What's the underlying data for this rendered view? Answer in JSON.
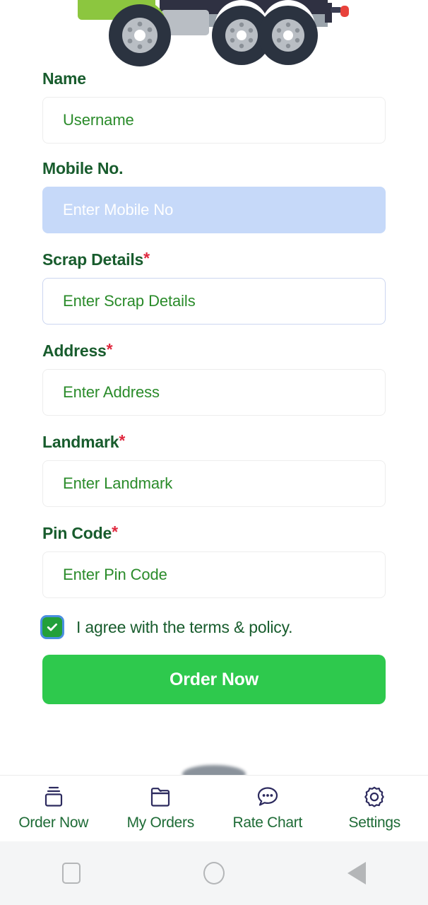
{
  "hero": {
    "illustration": "scrap-collection-truck",
    "colors": {
      "cab": "#8cc63f",
      "body": "#2f3142",
      "chassis": "#9aa3ab",
      "tire": "#2b3340",
      "rim": "#b9bec4",
      "taillight": "#e8423b"
    }
  },
  "form": {
    "fields": [
      {
        "label": "Name",
        "required": false,
        "placeholder": "Username",
        "state": "default"
      },
      {
        "label": "Mobile No.",
        "required": false,
        "placeholder": "Enter Mobile No",
        "state": "highlighted"
      },
      {
        "label": "Scrap Details",
        "required": true,
        "placeholder": "Enter Scrap Details",
        "state": "focused"
      },
      {
        "label": "Address",
        "required": true,
        "placeholder": "Enter Address",
        "state": "default"
      },
      {
        "label": "Landmark",
        "required": true,
        "placeholder": "Enter Landmark",
        "state": "default"
      },
      {
        "label": "Pin Code",
        "required": true,
        "placeholder": "Enter Pin Code",
        "state": "default"
      }
    ],
    "required_marker": "*",
    "terms": {
      "text": "I agree with the terms & policy.",
      "checked": true
    },
    "submit_label": "Order Now"
  },
  "tabbar": {
    "items": [
      {
        "label": "Order Now",
        "icon": "box-icon"
      },
      {
        "label": "My Orders",
        "icon": "folder-icon"
      },
      {
        "label": "Rate Chart",
        "icon": "chat-dots-icon"
      },
      {
        "label": "Settings",
        "icon": "gear-icon"
      }
    ]
  },
  "system_nav": {
    "buttons": [
      {
        "name": "recents",
        "icon": "square-icon"
      },
      {
        "name": "home",
        "icon": "circle-icon"
      },
      {
        "name": "back",
        "icon": "triangle-left-icon"
      }
    ]
  },
  "colors": {
    "label_green": "#185c2d",
    "placeholder_green": "#2a8b2a",
    "accent_green": "#2ec94d",
    "checkbox_green": "#23a03a",
    "required_red": "#e0293f",
    "highlight_blue": "#c6d9f9",
    "nav_icon_navy": "#2c2a5e",
    "tab_label_green": "#1e6b36"
  }
}
